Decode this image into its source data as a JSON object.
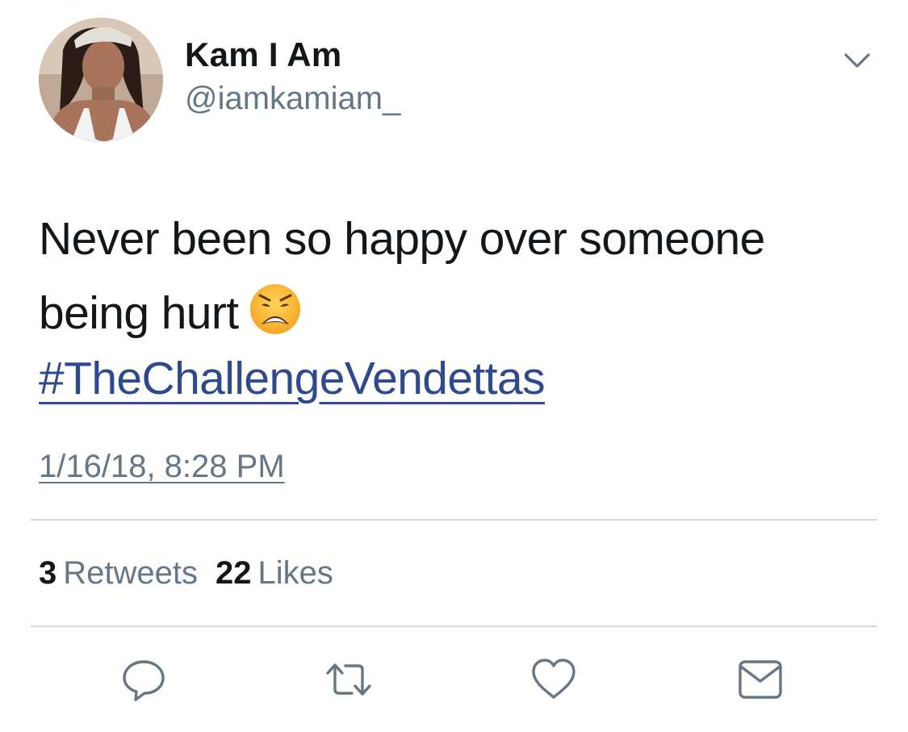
{
  "user": {
    "display_name": "Kam I Am",
    "handle": "@iamkamiam_"
  },
  "tweet": {
    "text_line1": "Never been so happy over someone",
    "text_line2": "being hurt",
    "emoji": "weary-face",
    "hashtag": "#TheChallengeVendettas",
    "timestamp": "1/16/18, 8:28 PM"
  },
  "stats": {
    "retweets_count": "3",
    "retweets_label": "Retweets",
    "likes_count": "22",
    "likes_label": "Likes"
  },
  "actions": [
    "reply-icon",
    "retweet-icon",
    "like-icon",
    "direct-message-icon"
  ],
  "colors": {
    "text": "#14171a",
    "secondary": "#657786",
    "link": "#2e4a8c",
    "divider": "#d6d9dc"
  }
}
